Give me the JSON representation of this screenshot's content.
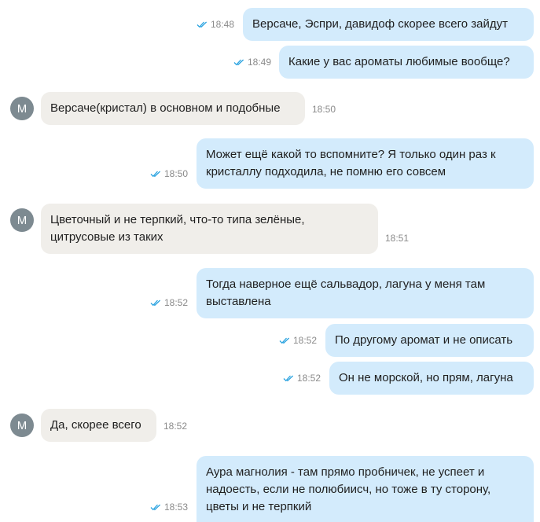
{
  "colors": {
    "outgoing_bubble": "#d3ebfc",
    "incoming_bubble": "#f0eeea",
    "read_check": "#2aa3e0",
    "avatar": "#7d8a91"
  },
  "avatar_letter": "М",
  "messages": [
    {
      "dir": "out",
      "text": "Версаче, Эспри, давидоф скорее всего зайдут",
      "time": "18:48",
      "read": true
    },
    {
      "dir": "out",
      "text": "Какие у вас ароматы любимые вообще?",
      "time": "18:49",
      "read": true
    },
    {
      "dir": "in",
      "text": "Версаче(кристал) в основном и подобные",
      "time": "18:50"
    },
    {
      "dir": "out",
      "lines": [
        "Может ещё какой то вспомните? Я только один раз к",
        "кристаллу подходила, не помню его совсем"
      ],
      "time": "18:50",
      "read": true
    },
    {
      "dir": "in",
      "lines": [
        "Цветочный и не терпкий, что-то типа зелёные,",
        "цитрусовые из таких"
      ],
      "time": "18:51"
    },
    {
      "dir": "out",
      "lines": [
        "Тогда наверное ещё сальвадор, лагуна у меня там",
        "выставлена"
      ],
      "time": "18:52",
      "read": true
    },
    {
      "dir": "out",
      "text": "По другому аромат и не описать",
      "time": "18:52",
      "read": true
    },
    {
      "dir": "out",
      "text": "Он не морской, но прям, лагуна",
      "time": "18:52",
      "read": true
    },
    {
      "dir": "in",
      "text": "Да, скорее всего",
      "time": "18:52"
    },
    {
      "dir": "out",
      "lines": [
        "Аура магнолия - там прямо пробничек, не успеет и",
        "надоесть, если не полюбиисч, но тоже в ту сторону,",
        "цветы и не терпкий"
      ],
      "time": "18:53",
      "read": true
    }
  ]
}
